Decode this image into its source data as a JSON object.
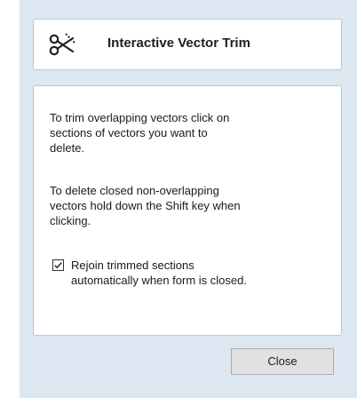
{
  "header": {
    "title": "Interactive Vector Trim",
    "icon": "scissors-icon"
  },
  "body": {
    "paragraph1": "To trim overlapping vectors click on sections of vectors you want to delete.",
    "paragraph2": "To delete closed non-overlapping vectors hold down the Shift key when clicking.",
    "rejoin_checkbox": {
      "label": "Rejoin trimmed sections automatically when form is closed.",
      "checked": true
    }
  },
  "footer": {
    "close_label": "Close"
  },
  "colors": {
    "panel_background": "#dde7f2",
    "card_border": "#b9c7d6",
    "button_background": "#e1e1e1"
  }
}
